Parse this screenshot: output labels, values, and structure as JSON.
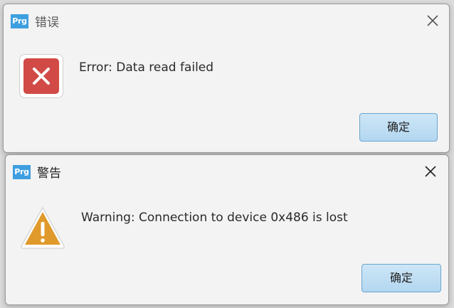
{
  "error_dialog": {
    "app_icon_text": "Prg",
    "title": "错误",
    "icon": "error-icon",
    "message": "Error: Data read failed",
    "ok_label": "确定"
  },
  "warning_dialog": {
    "app_icon_text": "Prg",
    "title": "警告",
    "icon": "warning-icon",
    "message": "Warning: Connection to device 0x486 is lost",
    "ok_label": "确定"
  },
  "colors": {
    "app_icon": "#3e9fe0",
    "error_icon": "#d14a46",
    "warning_icon": "#e0992b",
    "button_bg": "#b3d7f0"
  }
}
